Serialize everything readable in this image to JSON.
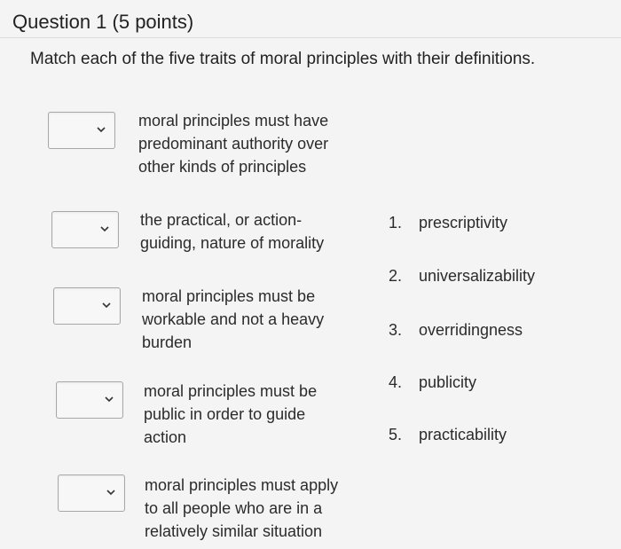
{
  "question": {
    "title": "Question 1 (5 points)",
    "instructions": "Match each of the five traits of moral principles with their definitions."
  },
  "definitions": [
    {
      "lines": [
        "moral principles must have",
        "predominant authority over",
        "other kinds of principles"
      ],
      "selected": ""
    },
    {
      "lines": [
        "the practical, or action-",
        "guiding, nature of morality"
      ],
      "selected": ""
    },
    {
      "lines": [
        "moral principles must be",
        "workable and not a heavy",
        "burden"
      ],
      "selected": ""
    },
    {
      "lines": [
        "moral principles must be",
        "public in order to guide",
        "action"
      ],
      "selected": ""
    },
    {
      "lines": [
        "moral principles must apply",
        "to all people who are in a",
        "relatively similar situation"
      ],
      "selected": ""
    }
  ],
  "answers": [
    {
      "num": "1.",
      "label": "prescriptivity"
    },
    {
      "num": "2.",
      "label": "universalizability"
    },
    {
      "num": "3.",
      "label": "overridingness"
    },
    {
      "num": "4.",
      "label": "publicity"
    },
    {
      "num": "5.",
      "label": "practicability"
    }
  ],
  "icons": {
    "dropdown": "chevron-down-icon"
  }
}
